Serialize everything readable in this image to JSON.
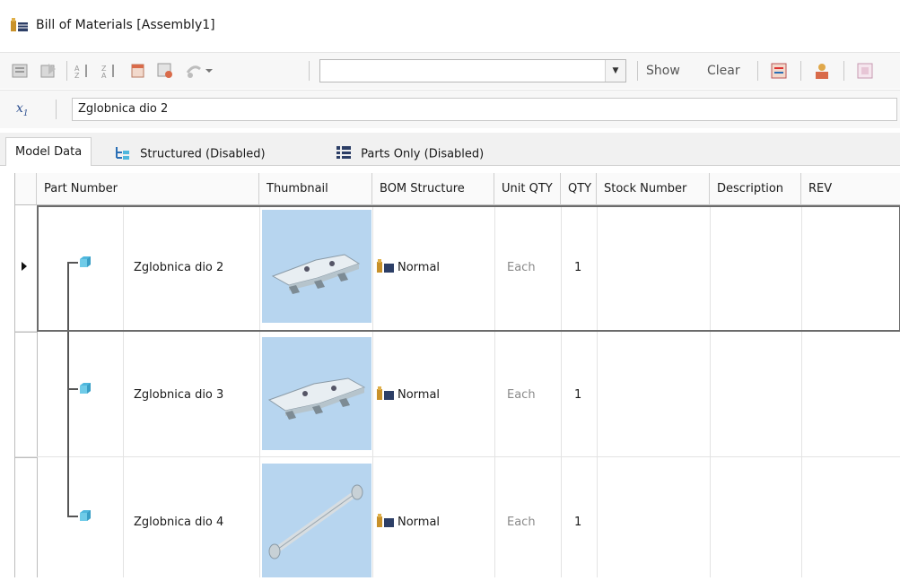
{
  "window": {
    "title": "Bill of Materials [Assembly1]"
  },
  "toolbar": {
    "show_label": "Show",
    "clear_label": "Clear",
    "combo_value": ""
  },
  "filter": {
    "value": "Zglobnica dio 2"
  },
  "tabs": [
    {
      "label": "Model Data",
      "active": true
    },
    {
      "label": "Structured (Disabled)",
      "active": false
    },
    {
      "label": "Parts Only (Disabled)",
      "active": false
    }
  ],
  "grid": {
    "columns": [
      "Part Number",
      "Thumbnail",
      "BOM Structure",
      "Unit QTY",
      "QTY",
      "Stock Number",
      "Description",
      "REV"
    ],
    "rows": [
      {
        "part_number": "Zglobnica dio 2",
        "thumbnail": "hinge-plate",
        "bom_structure": "Normal",
        "unit_qty": "Each",
        "qty": "1",
        "stock_number": "",
        "description": "",
        "rev": "",
        "selected": true
      },
      {
        "part_number": "Zglobnica dio 3",
        "thumbnail": "hinge-plate",
        "bom_structure": "Normal",
        "unit_qty": "Each",
        "qty": "1",
        "stock_number": "",
        "description": "",
        "rev": "",
        "selected": false
      },
      {
        "part_number": "Zglobnica dio 4",
        "thumbnail": "hinge-pin",
        "bom_structure": "Normal",
        "unit_qty": "Each",
        "qty": "1",
        "stock_number": "",
        "description": "",
        "rev": "",
        "selected": false
      }
    ]
  },
  "colors": {
    "thumbnail_bg": "#b7d5ef",
    "part_icon": "#4fb7dd",
    "selection_border": "#6b6b6b"
  }
}
